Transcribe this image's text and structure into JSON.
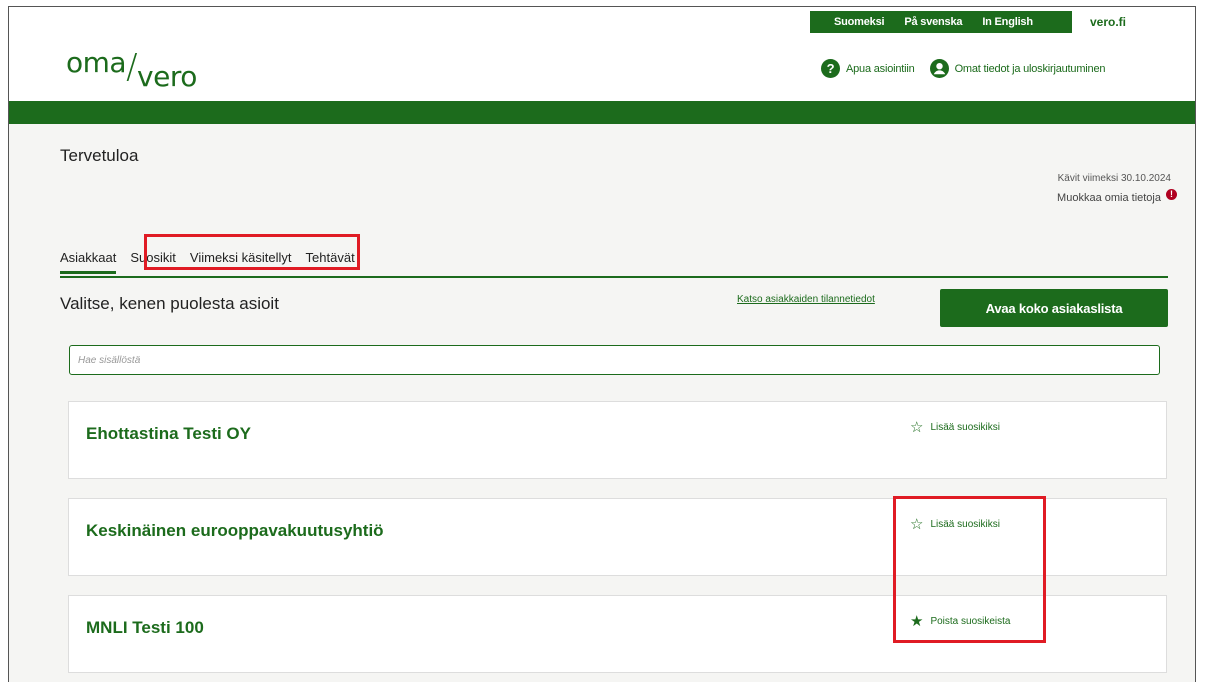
{
  "header": {
    "languages": [
      "Suomeksi",
      "På svenska",
      "In English"
    ],
    "site_link": "vero.fi",
    "logo_oma": "oma",
    "logo_slash": "/",
    "logo_vero": "vero",
    "help_label": "Apua asiointiin",
    "help_icon": "question-circle-icon",
    "profile_label": "Omat tiedot ja uloskirjautuminen",
    "profile_icon": "user-circle-icon"
  },
  "page": {
    "welcome": "Tervetuloa",
    "last_visit": "Kävit viimeksi 30.10.2024",
    "edit_info": "Muokkaa omia tietoja",
    "edit_alert": "!"
  },
  "tabs": [
    {
      "label": "Asiakkaat",
      "active": true
    },
    {
      "label": "Suosikit",
      "active": false
    },
    {
      "label": "Viimeksi käsitellyt",
      "active": false
    },
    {
      "label": "Tehtävät",
      "active": false
    }
  ],
  "customers": {
    "heading": "Valitse, kenen puolesta asioit",
    "status_link": "Katso asiakkaiden tilannetiedot",
    "open_list_button": "Avaa koko asiakaslista",
    "search_placeholder": "Hae sisällöstä",
    "items": [
      {
        "name": "Ehottastina Testi OY",
        "fav_label": "Lisää suosikiksi",
        "fav_icon": "star-outline-icon"
      },
      {
        "name": "Keskinäinen eurooppavakuutusyhtiö",
        "fav_label": "Lisää suosikiksi",
        "fav_icon": "star-outline-icon"
      },
      {
        "name": "MNLI Testi 100",
        "fav_label": "Poista suosikeista",
        "fav_icon": "star-filled-icon"
      }
    ]
  },
  "colors": {
    "brand_green": "#1c6b1c",
    "highlight_red": "#e01b24",
    "background": "#f5f5f3"
  }
}
